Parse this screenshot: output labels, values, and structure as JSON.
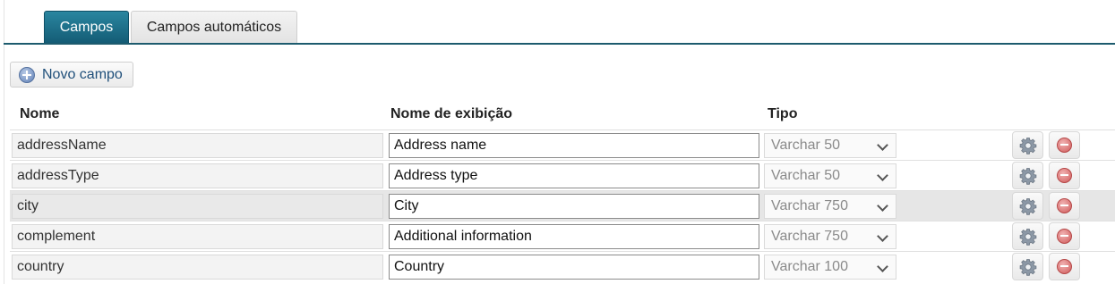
{
  "tabs": [
    {
      "label": "Campos",
      "active": true
    },
    {
      "label": "Campos automáticos",
      "active": false
    }
  ],
  "toolbar": {
    "new_field_label": "Novo campo",
    "new_field_icon": "plus-circle-icon"
  },
  "table": {
    "headers": {
      "name": "Nome",
      "display_name": "Nome de exibição",
      "type": "Tipo"
    },
    "rows": [
      {
        "name": "addressName",
        "display_name": "Address name",
        "type": "Varchar 50",
        "highlighted": false
      },
      {
        "name": "addressType",
        "display_name": "Address type",
        "type": "Varchar 50",
        "highlighted": false
      },
      {
        "name": "city",
        "display_name": "City",
        "type": "Varchar 750",
        "highlighted": true
      },
      {
        "name": "complement",
        "display_name": "Additional information",
        "type": "Varchar 750",
        "highlighted": false
      },
      {
        "name": "country",
        "display_name": "Country",
        "type": "Varchar 100",
        "highlighted": false
      }
    ],
    "row_actions": {
      "settings_icon": "gear-icon",
      "delete_icon": "minus-circle-icon"
    }
  },
  "colors": {
    "tab_active": "#145c75",
    "tab_rule": "#1d5b6e",
    "link_text": "#1f4f7a",
    "row_highlight": "#e6e6e6"
  }
}
